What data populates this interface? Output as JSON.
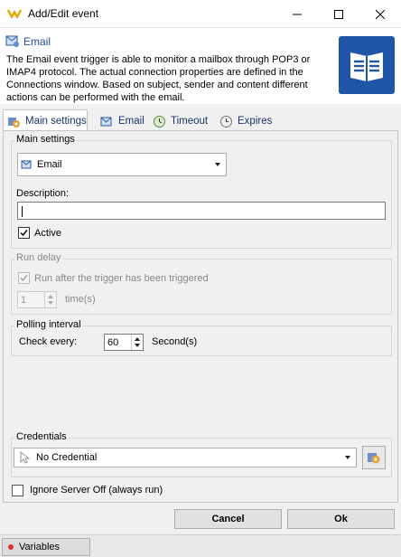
{
  "window": {
    "title": "Add/Edit event",
    "minimize_icon": "minimize-icon",
    "maximize_icon": "maximize-icon",
    "close_icon": "close-icon"
  },
  "header": {
    "title": "Email",
    "description": "The Email event trigger is able to monitor a mailbox through POP3 or IMAP4 protocol. The actual connection properties are defined in the Connections window. Based on subject, sender and content different actions can be performed with the email.",
    "big_icon": "document-lines-icon",
    "accent_color": "#1f56a8"
  },
  "tabs": [
    {
      "label": "Main settings",
      "icon": "gear-icon",
      "active": true
    },
    {
      "label": "Email",
      "icon": "email-icon",
      "active": false
    },
    {
      "label": "Timeout",
      "icon": "timeout-icon",
      "active": false
    },
    {
      "label": "Expires",
      "icon": "expires-icon",
      "active": false
    }
  ],
  "main_settings": {
    "group_label": "Main settings",
    "trigger_type": "Email",
    "description_label": "Description:",
    "description_value": "",
    "active_label": "Active",
    "active_checked": true
  },
  "run_delay": {
    "group_label": "Run delay",
    "run_after_label": "Run after the trigger has been triggered",
    "run_after_checked": true,
    "times_value": "1",
    "times_label": "time(s)"
  },
  "polling": {
    "group_label": "Polling interval",
    "check_every_label": "Check every:",
    "value": "60",
    "unit_label": "Second(s)"
  },
  "credentials": {
    "group_label": "Credentials",
    "selected": "No Credential"
  },
  "ignore_server_off": {
    "label": "Ignore Server Off (always run)",
    "checked": false
  },
  "buttons": {
    "cancel": "Cancel",
    "ok": "Ok"
  },
  "statusbar": {
    "variables": "Variables"
  }
}
